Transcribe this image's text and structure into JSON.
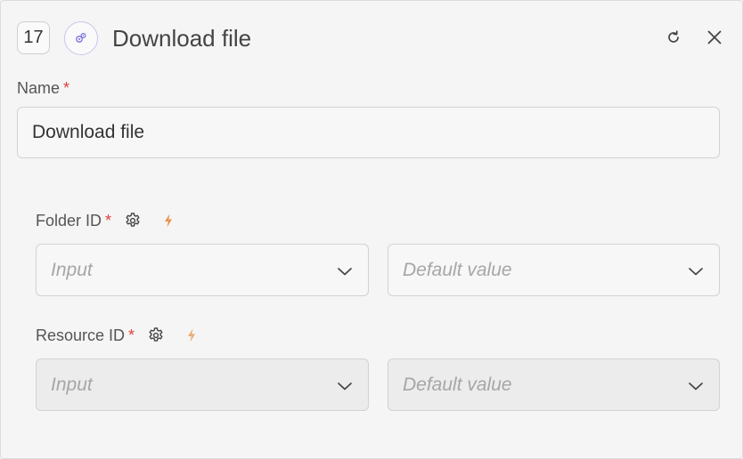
{
  "header": {
    "step_number": "17",
    "title": "Download file"
  },
  "name_field": {
    "label": "Name",
    "required_mark": "*",
    "value": "Download file"
  },
  "params": [
    {
      "label": "Folder ID",
      "required_mark": "*",
      "input_placeholder": "Input",
      "default_placeholder": "Default value"
    },
    {
      "label": "Resource ID",
      "required_mark": "*",
      "input_placeholder": "Input",
      "default_placeholder": "Default value"
    }
  ],
  "icons": {
    "app": "integration-gear-icon",
    "refresh": "refresh-icon",
    "close": "close-icon",
    "settings": "gear-icon",
    "dynamic": "lightning-bolt-icon",
    "dropdown": "chevron-down-icon"
  },
  "colors": {
    "required": "#e0413a",
    "bolt": "#e8944a",
    "app_icon": "#7b6fe0"
  }
}
